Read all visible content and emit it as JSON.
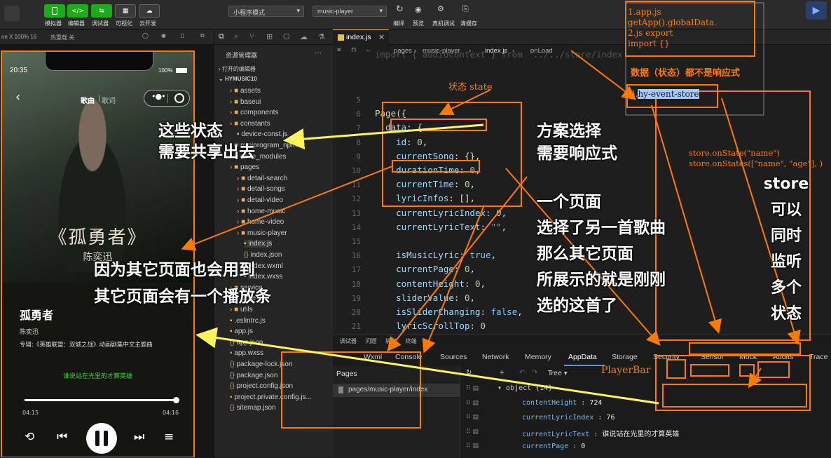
{
  "toolbar": {
    "buttons": [
      {
        "icon": "phone-icon",
        "label": "模拟器"
      },
      {
        "icon": "code-icon",
        "label": "编辑器"
      },
      {
        "icon": "debug-icon",
        "label": "调试器"
      },
      {
        "icon": "layout-icon",
        "label": "可视化"
      },
      {
        "icon": "cloud-icon",
        "label": "云开发"
      }
    ],
    "mode_select": "小程序模式",
    "project_select": "music-player",
    "right_buttons": [
      {
        "icon": "compile-icon",
        "label": "编译"
      },
      {
        "icon": "preview-icon",
        "label": "预览"
      },
      {
        "icon": "debug-device-icon",
        "label": "真机调试"
      },
      {
        "icon": "clear-cache-icon",
        "label": "清缓存"
      }
    ],
    "accent_green": "#1aad19"
  },
  "subbar": {
    "device": "ne X 100% 16",
    "hot_reload": "热重载 关"
  },
  "simulator": {
    "time": "20:35",
    "battery": "100%",
    "nav_song": "歌曲",
    "nav_lyric": "歌词",
    "poster_title": "《孤勇者》",
    "poster_artist": "陈奕迅",
    "song_name": "孤勇者",
    "artist": "陈奕迅",
    "album": "专辑:《英雄联盟：双城之战》动画剧集中文主题曲",
    "lyric": "谁说站在光里的才算英雄",
    "time_current": "04:15",
    "time_total": "04:16",
    "progress": 0.98
  },
  "explorer": {
    "title": "资源管理器",
    "open_editors": "打开的编辑器",
    "project": "HYMUSIC10",
    "items": [
      {
        "name": "assets",
        "type": "folder",
        "level": 1
      },
      {
        "name": "baseui",
        "type": "folder",
        "level": 1
      },
      {
        "name": "components",
        "type": "folder",
        "level": 1
      },
      {
        "name": "constants",
        "type": "folder",
        "level": 1
      },
      {
        "name": "device-const.js",
        "type": "file",
        "level": 2
      },
      {
        "name": "miniprogram_npm",
        "type": "folder",
        "level": 1
      },
      {
        "name": "node_modules",
        "type": "folder",
        "level": 1
      },
      {
        "name": "pages",
        "type": "folder",
        "level": 1
      },
      {
        "name": "detail-search",
        "type": "folder",
        "level": 2
      },
      {
        "name": "detail-songs",
        "type": "folder",
        "level": 2
      },
      {
        "name": "detail-video",
        "type": "folder",
        "level": 2
      },
      {
        "name": "home-music",
        "type": "folder",
        "level": 2
      },
      {
        "name": "home-video",
        "type": "folder",
        "level": 2
      },
      {
        "name": "music-player",
        "type": "folder",
        "level": 2
      },
      {
        "name": "index.js",
        "type": "file",
        "level": 3
      },
      {
        "name": "index.json",
        "type": "file",
        "level": 3
      },
      {
        "name": "index.wxml",
        "type": "file",
        "level": 3
      },
      {
        "name": "index.wxss",
        "type": "file",
        "level": 3
      },
      {
        "name": "service",
        "type": "folder",
        "level": 1
      },
      {
        "name": "store",
        "type": "folder",
        "level": 1
      },
      {
        "name": "utils",
        "type": "folder",
        "level": 1
      },
      {
        "name": ".eslintrc.js",
        "type": "file",
        "level": 1
      },
      {
        "name": "app.js",
        "type": "file",
        "level": 1
      },
      {
        "name": "app.json",
        "type": "file",
        "level": 1
      },
      {
        "name": "app.wxss",
        "type": "file",
        "level": 1
      },
      {
        "name": "package-lock.json",
        "type": "file",
        "level": 1
      },
      {
        "name": "package.json",
        "type": "file",
        "level": 1
      },
      {
        "name": "project.config.json",
        "type": "file",
        "level": 1
      },
      {
        "name": "project.private.config.js...",
        "type": "file",
        "level": 1
      },
      {
        "name": "sitemap.json",
        "type": "file",
        "level": 1
      }
    ]
  },
  "editor": {
    "tab": "index.js",
    "breadcrumb": [
      "pages",
      "music-player",
      "index.js",
      "onLoad"
    ],
    "top_line": "import { audioContext } from '../../store/index'",
    "lines": [
      {
        "n": "5",
        "t": ""
      },
      {
        "n": "6",
        "t": "Page({"
      },
      {
        "n": "7",
        "t": "  data: {"
      },
      {
        "n": "8",
        "t": "    id: 0,"
      },
      {
        "n": "9",
        "t": "    currentSong: {},"
      },
      {
        "n": "10",
        "t": "    durationTime: 0,"
      },
      {
        "n": "11",
        "t": "    currentTime: 0,"
      },
      {
        "n": "12",
        "t": "    lyricInfos: [],"
      },
      {
        "n": "13",
        "t": "    currentLyricIndex: 0,"
      },
      {
        "n": "14",
        "t": "    currentLyricText: \"\","
      },
      {
        "n": "15",
        "t": ""
      },
      {
        "n": "16",
        "t": "    isMusicLyric: true,"
      },
      {
        "n": "17",
        "t": "    currentPage: 0,"
      },
      {
        "n": "18",
        "t": "    contentHeight: 0,"
      },
      {
        "n": "19",
        "t": "    sliderValue: 0,"
      },
      {
        "n": "20",
        "t": "    isSliderChanging: false,"
      },
      {
        "n": "21",
        "t": "    lyricScrollTop: 0"
      },
      {
        "n": "22",
        "t": "  },"
      },
      {
        "n": "23",
        "t": "  onLoad: function (options) {"
      }
    ]
  },
  "devtools": {
    "subtabs": [
      "调试器",
      "问题",
      "输出",
      "终端"
    ],
    "tabs": [
      "Wxml",
      "Console",
      "Sources",
      "Network",
      "Memory",
      "AppData",
      "Storage",
      "Security",
      "Sensor",
      "Mock",
      "Audits",
      "Trace"
    ],
    "active_tab": "AppData",
    "pages_title": "Pages",
    "page_path": "pages/music-player/index",
    "tree_mode": "Tree",
    "object_label": "object {14}",
    "rows": [
      {
        "key": "contentHeight",
        "value": "724"
      },
      {
        "key": "currentLyricIndex",
        "value": "76"
      },
      {
        "key": "currentLyricText",
        "value": "谁说站在光里的才算英雄"
      },
      {
        "key": "currentPage",
        "value": "0"
      }
    ]
  },
  "annotations": {
    "note_box": [
      "1.app.js",
      "getApp().globalData.",
      "2.js export",
      "import {}"
    ],
    "not_reactive": "数据（状态）都不是响应式",
    "hy_event_store_num": "3.",
    "hy_event_store": "hy-event-store",
    "state_label": "状态 state",
    "share_state": [
      "这些状态",
      "需要共享出去"
    ],
    "reactive_plan": [
      "方案选择",
      "需要响应式"
    ],
    "scenario": [
      "一个页面",
      "选择了另一首歌曲",
      "那么其它页面",
      "所展示的就是刚刚",
      "选的这首了"
    ],
    "other_pages": [
      "因为其它页面也会用到",
      "其它页面会有一个播放条"
    ],
    "store_api": [
      "store.onState(\"name\")",
      "store.onStates([\"name\", \"age\"], )"
    ],
    "store_multi": [
      "store",
      "可以",
      "同时",
      "监听",
      "多个",
      "状态"
    ],
    "playerbar_label": "PlayerBar",
    "orange": "#ff7a00"
  }
}
